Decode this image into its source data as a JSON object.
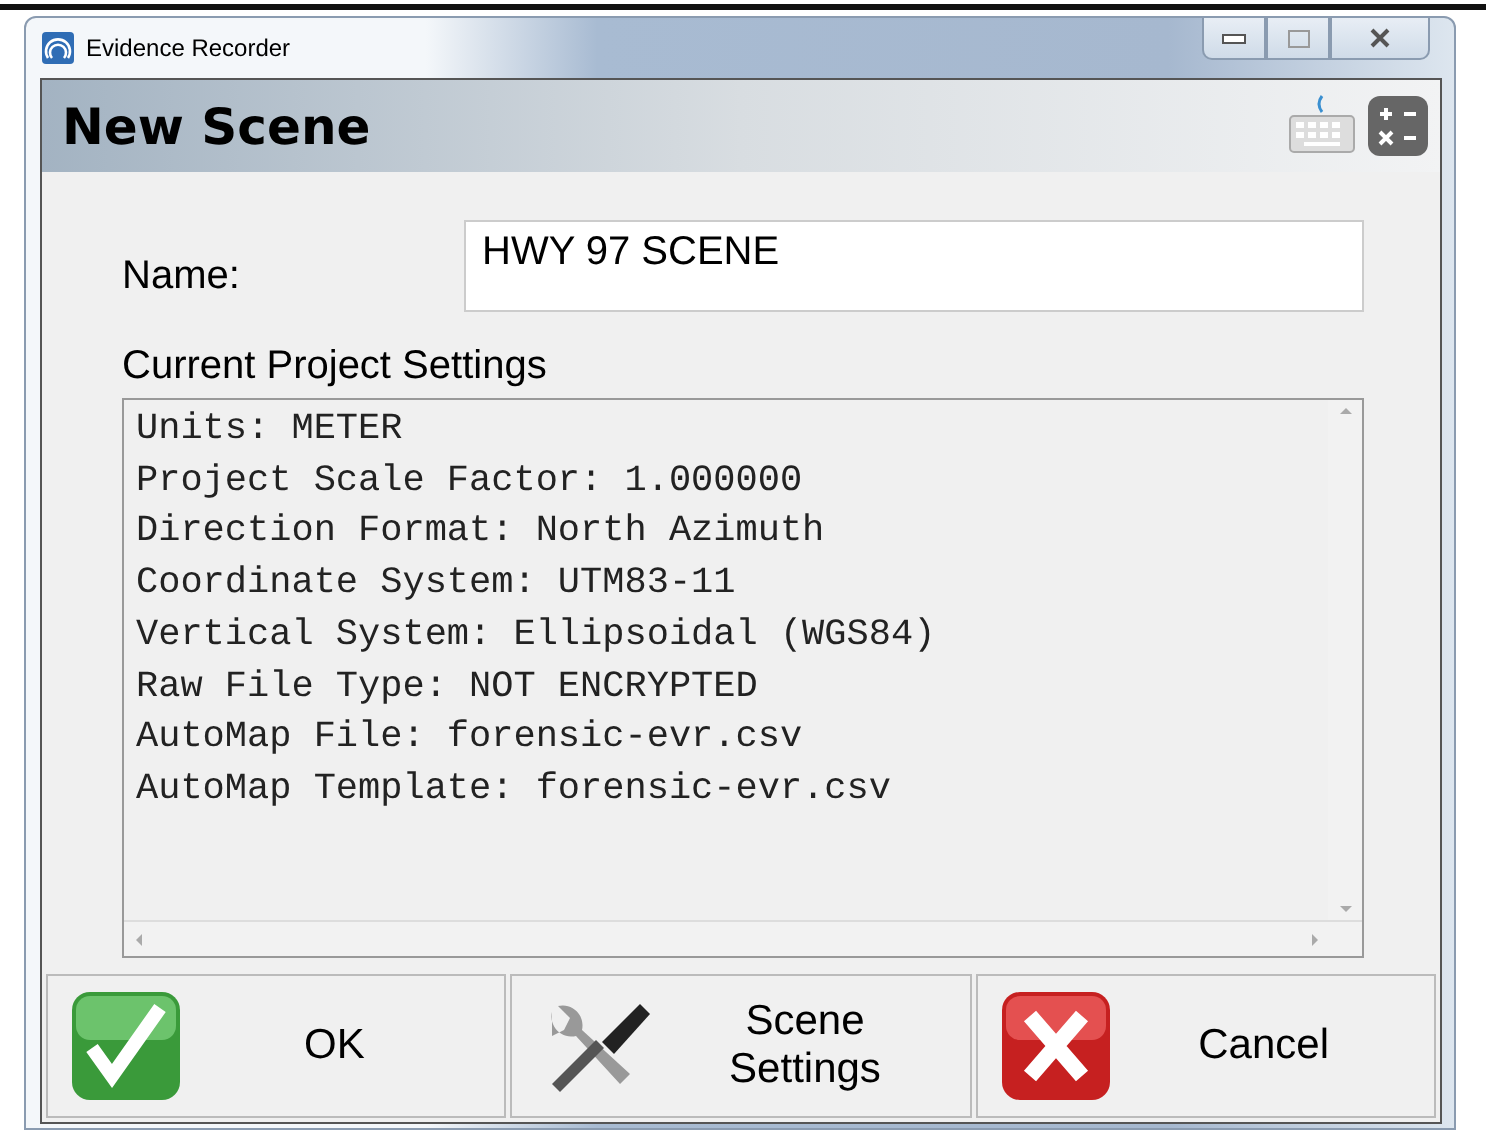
{
  "window": {
    "title": "Evidence Recorder"
  },
  "header": {
    "title": "New Scene"
  },
  "name_field": {
    "label": "Name:",
    "value": "HWY 97 SCENE"
  },
  "settings": {
    "label": "Current Project Settings",
    "lines": [
      "Units: METER",
      "Project Scale Factor: 1.000000",
      "Direction Format: North Azimuth",
      "Coordinate System: UTM83-11",
      "Vertical System: Ellipsoidal (WGS84)",
      "Raw File Type: NOT ENCRYPTED",
      "AutoMap File: forensic-evr.csv",
      "AutoMap Template: forensic-evr.csv"
    ]
  },
  "buttons": [
    {
      "kind": "ok",
      "label": "OK"
    },
    {
      "kind": "settings",
      "label": "Scene Settings"
    },
    {
      "kind": "cancel",
      "label": "Cancel"
    }
  ]
}
